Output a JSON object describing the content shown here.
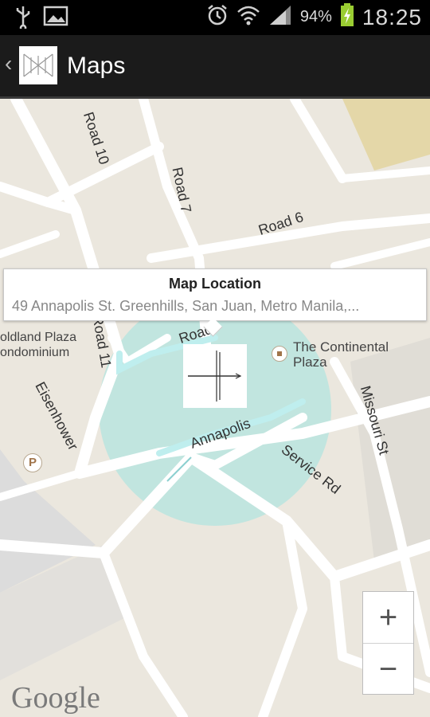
{
  "status_bar": {
    "icons": [
      "usb-icon",
      "image-icon",
      "alarm-icon",
      "wifi-icon",
      "signal-icon",
      "battery-charging-icon"
    ],
    "battery": "94%",
    "time": "18:25"
  },
  "action_bar": {
    "title": "Maps"
  },
  "map": {
    "road_labels": [
      "Road 10",
      "Road 7",
      "Road 6",
      "Road 11",
      "Roads",
      "Eisenhower",
      "Annapolis",
      "Service Rd",
      "Missouri St"
    ],
    "places": {
      "left": "oldland Plaza\nondominium",
      "right": "The Continental\nPlaza"
    },
    "info_window": {
      "title": "Map Location",
      "snippet": "49 Annapolis St. Greenhills, San Juan, Metro Manila,..."
    },
    "zoom": {
      "in": "+",
      "out": "−"
    },
    "attribution": "Google",
    "parking": "P"
  }
}
